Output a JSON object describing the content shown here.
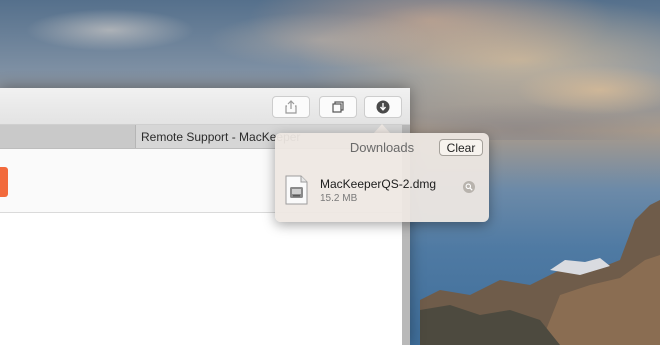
{
  "toolbar": {
    "buttons": [
      {
        "name": "share-icon"
      },
      {
        "name": "tabs-overview-icon"
      },
      {
        "name": "downloads-icon"
      }
    ]
  },
  "tab": {
    "title": "Remote Support - MacKeeper"
  },
  "downloads": {
    "title": "Downloads",
    "clear_label": "Clear",
    "items": [
      {
        "filename": "MacKeeperQS-2.dmg",
        "size": "15.2 MB",
        "icon": "disk-image-icon"
      }
    ]
  },
  "colors": {
    "accent_orange": "#f26a3c"
  }
}
